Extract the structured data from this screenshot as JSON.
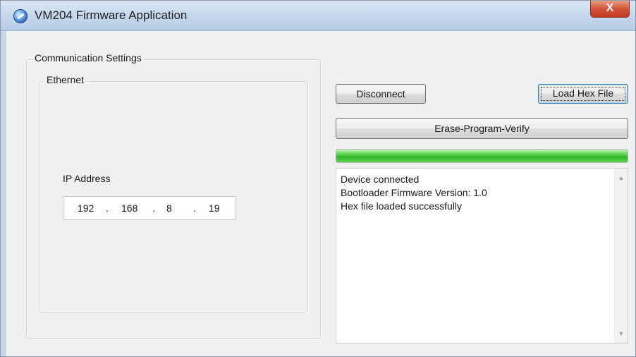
{
  "window": {
    "title": "VM204 Firmware Application",
    "close_label": "X",
    "app_icon": "app-globe-icon"
  },
  "comm": {
    "group_label": "Communication Settings",
    "ethernet_label": "Ethernet",
    "ip_label": "IP Address",
    "ip": [
      "192",
      "168",
      "8",
      "19"
    ],
    "ip_separator": "."
  },
  "actions": {
    "disconnect_label": "Disconnect",
    "load_hex_label": "Load Hex File",
    "erase_program_verify_label": "Erase-Program-Verify"
  },
  "progress": {
    "percent": 100,
    "color": "#34b52c"
  },
  "log": {
    "lines": [
      "Device connected",
      "Bootloader Firmware Version: 1.0",
      "Hex file loaded successfully"
    ],
    "scroll_up_icon": "scroll-up-arrow-icon",
    "scroll_down_icon": "scroll-down-arrow-icon"
  }
}
